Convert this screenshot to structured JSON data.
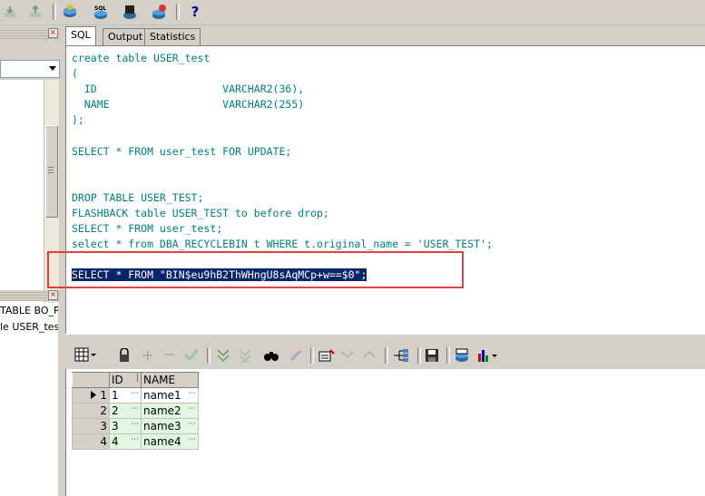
{
  "toolbar": {
    "icons": [
      "import-icon",
      "export-icon",
      "sql-icon",
      "sql-exec-icon",
      "stop-icon",
      "commit-icon",
      "help-icon"
    ],
    "help_label": "?"
  },
  "left_panel": {
    "lines": [
      "TABLE BO_P",
      "le USER_tes"
    ]
  },
  "tabs": [
    {
      "label": "SQL",
      "active": true
    },
    {
      "label": "Output",
      "active": false
    },
    {
      "label": "Statistics",
      "active": false
    }
  ],
  "editor": {
    "lines": [
      "create table USER_test",
      "(",
      "  ID                    VARCHAR2(36),",
      "  NAME                  VARCHAR2(255)",
      ");",
      "",
      "SELECT * FROM user_test FOR UPDATE;",
      "",
      "",
      "DROP TABLE USER_TEST;",
      "FLASHBACK table USER_TEST to before drop;",
      "SELECT * FROM user_test;",
      "select * from DBA_RECYCLEBIN t WHERE t.original_name = 'USER_TEST';",
      "",
      "SELECT * FROM \"BIN$eu9hB2ThWHngU8sAqMCp+w==$0\";"
    ],
    "selected_line_index": 14
  },
  "grid": {
    "columns": [
      "ID",
      "NAME"
    ],
    "rows": [
      {
        "num": "1",
        "id": "1",
        "name": "name1",
        "current": true
      },
      {
        "num": "2",
        "id": "2",
        "name": "name2",
        "current": false
      },
      {
        "num": "3",
        "id": "3",
        "name": "name3",
        "current": false
      },
      {
        "num": "4",
        "id": "4",
        "name": "name4",
        "current": false
      }
    ],
    "ellipsis": "⋯"
  },
  "colors": {
    "keyword": "#0000c0",
    "text": "#008080",
    "selection": "#0a246a",
    "highlight_box": "#e04040",
    "cell_green": "#e0f8e0"
  }
}
